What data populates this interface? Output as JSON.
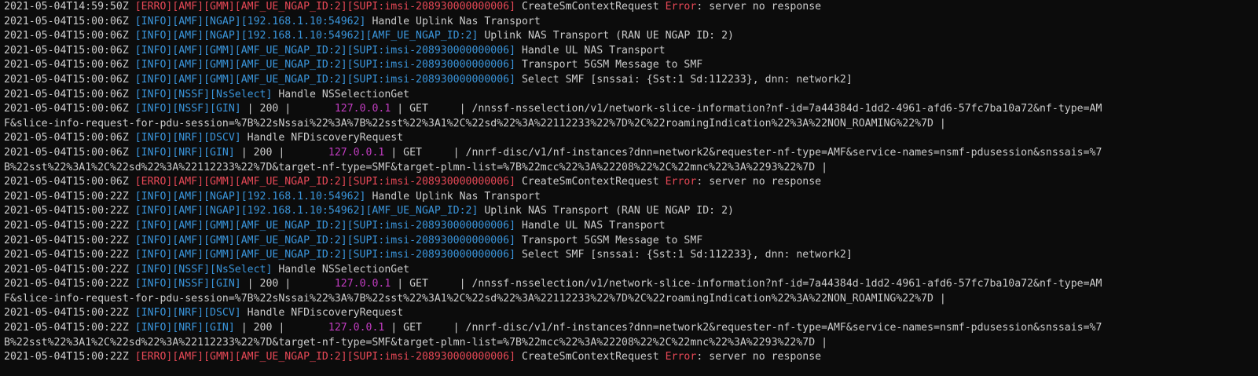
{
  "terminal": {
    "lines": [
      [
        {
          "t": "2021-05-04T14:59:50Z ",
          "c": "ts"
        },
        {
          "t": "[ERRO][AMF][GMM][AMF_UE_NGAP_ID:2][SUPI:imsi-208930000000006]",
          "c": "err"
        },
        {
          "t": " CreateSmContextRequest ",
          "c": "msg"
        },
        {
          "t": "Error",
          "c": "err"
        },
        {
          "t": ": server no response",
          "c": "msg"
        }
      ],
      [
        {
          "t": "2021-05-04T15:00:06Z ",
          "c": "ts"
        },
        {
          "t": "[INFO][AMF][NGAP][192.168.1.10:54962]",
          "c": "tag"
        },
        {
          "t": " Handle Uplink Nas Transport",
          "c": "msg"
        }
      ],
      [
        {
          "t": "2021-05-04T15:00:06Z ",
          "c": "ts"
        },
        {
          "t": "[INFO][AMF][NGAP][192.168.1.10:54962][AMF_UE_NGAP_ID:2]",
          "c": "tag"
        },
        {
          "t": " Uplink NAS Transport (RAN UE NGAP ID: 2)",
          "c": "msg"
        }
      ],
      [
        {
          "t": "2021-05-04T15:00:06Z ",
          "c": "ts"
        },
        {
          "t": "[INFO][AMF][GMM][AMF_UE_NGAP_ID:2][SUPI:imsi-208930000000006]",
          "c": "tag"
        },
        {
          "t": " Handle UL NAS Transport",
          "c": "msg"
        }
      ],
      [
        {
          "t": "2021-05-04T15:00:06Z ",
          "c": "ts"
        },
        {
          "t": "[INFO][AMF][GMM][AMF_UE_NGAP_ID:2][SUPI:imsi-208930000000006]",
          "c": "tag"
        },
        {
          "t": " Transport 5GSM Message to SMF",
          "c": "msg"
        }
      ],
      [
        {
          "t": "2021-05-04T15:00:06Z ",
          "c": "ts"
        },
        {
          "t": "[INFO][AMF][GMM][AMF_UE_NGAP_ID:2][SUPI:imsi-208930000000006]",
          "c": "tag"
        },
        {
          "t": " Select SMF [snssai: {Sst:1 Sd:112233}, dnn: network2]",
          "c": "msg"
        }
      ],
      [
        {
          "t": "2021-05-04T15:00:06Z ",
          "c": "ts"
        },
        {
          "t": "[INFO][NSSF][NsSelect]",
          "c": "tag"
        },
        {
          "t": " Handle NSSelectionGet",
          "c": "msg"
        }
      ],
      [
        {
          "t": "2021-05-04T15:00:06Z ",
          "c": "ts"
        },
        {
          "t": "[INFO][NSSF][GIN]",
          "c": "tag"
        },
        {
          "t": " | 200 |       ",
          "c": "msg"
        },
        {
          "t": "127.0.0.1",
          "c": "ip"
        },
        {
          "t": " | GET     | /nnssf-nsselection/v1/network-slice-information?nf-id=7a44384d-1dd2-4961-afd6-57fc7ba10a72&nf-type=AM",
          "c": "msg"
        }
      ],
      [
        {
          "t": "F&slice-info-request-for-pdu-session=%7B%22sNssai%22%3A%7B%22sst%22%3A1%2C%22sd%22%3A%22112233%22%7D%2C%22roamingIndication%22%3A%22NON_ROAMING%22%7D |",
          "c": "msg"
        }
      ],
      [
        {
          "t": "2021-05-04T15:00:06Z ",
          "c": "ts"
        },
        {
          "t": "[INFO][NRF][DSCV]",
          "c": "tag"
        },
        {
          "t": " Handle NFDiscoveryRequest",
          "c": "msg"
        }
      ],
      [
        {
          "t": "2021-05-04T15:00:06Z ",
          "c": "ts"
        },
        {
          "t": "[INFO][NRF][GIN]",
          "c": "tag"
        },
        {
          "t": " | 200 |       ",
          "c": "msg"
        },
        {
          "t": "127.0.0.1",
          "c": "ip"
        },
        {
          "t": " | GET     | /nnrf-disc/v1/nf-instances?dnn=network2&requester-nf-type=AMF&service-names=nsmf-pdusession&snssais=%7",
          "c": "msg"
        }
      ],
      [
        {
          "t": "B%22sst%22%3A1%2C%22sd%22%3A%22112233%22%7D&target-nf-type=SMF&target-plmn-list=%7B%22mcc%22%3A%22208%22%2C%22mnc%22%3A%2293%22%7D |",
          "c": "msg"
        }
      ],
      [
        {
          "t": "2021-05-04T15:00:06Z ",
          "c": "ts"
        },
        {
          "t": "[ERRO][AMF][GMM][AMF_UE_NGAP_ID:2][SUPI:imsi-208930000000006]",
          "c": "err"
        },
        {
          "t": " CreateSmContextRequest ",
          "c": "msg"
        },
        {
          "t": "Error",
          "c": "err"
        },
        {
          "t": ": server no response",
          "c": "msg"
        }
      ],
      [
        {
          "t": "2021-05-04T15:00:22Z ",
          "c": "ts"
        },
        {
          "t": "[INFO][AMF][NGAP][192.168.1.10:54962]",
          "c": "tag"
        },
        {
          "t": " Handle Uplink Nas Transport",
          "c": "msg"
        }
      ],
      [
        {
          "t": "2021-05-04T15:00:22Z ",
          "c": "ts"
        },
        {
          "t": "[INFO][AMF][NGAP][192.168.1.10:54962][AMF_UE_NGAP_ID:2]",
          "c": "tag"
        },
        {
          "t": " Uplink NAS Transport (RAN UE NGAP ID: 2)",
          "c": "msg"
        }
      ],
      [
        {
          "t": "2021-05-04T15:00:22Z ",
          "c": "ts"
        },
        {
          "t": "[INFO][AMF][GMM][AMF_UE_NGAP_ID:2][SUPI:imsi-208930000000006]",
          "c": "tag"
        },
        {
          "t": " Handle UL NAS Transport",
          "c": "msg"
        }
      ],
      [
        {
          "t": "2021-05-04T15:00:22Z ",
          "c": "ts"
        },
        {
          "t": "[INFO][AMF][GMM][AMF_UE_NGAP_ID:2][SUPI:imsi-208930000000006]",
          "c": "tag"
        },
        {
          "t": " Transport 5GSM Message to SMF",
          "c": "msg"
        }
      ],
      [
        {
          "t": "2021-05-04T15:00:22Z ",
          "c": "ts"
        },
        {
          "t": "[INFO][AMF][GMM][AMF_UE_NGAP_ID:2][SUPI:imsi-208930000000006]",
          "c": "tag"
        },
        {
          "t": " Select SMF [snssai: {Sst:1 Sd:112233}, dnn: network2]",
          "c": "msg"
        }
      ],
      [
        {
          "t": "2021-05-04T15:00:22Z ",
          "c": "ts"
        },
        {
          "t": "[INFO][NSSF][NsSelect]",
          "c": "tag"
        },
        {
          "t": " Handle NSSelectionGet",
          "c": "msg"
        }
      ],
      [
        {
          "t": "2021-05-04T15:00:22Z ",
          "c": "ts"
        },
        {
          "t": "[INFO][NSSF][GIN]",
          "c": "tag"
        },
        {
          "t": " | 200 |       ",
          "c": "msg"
        },
        {
          "t": "127.0.0.1",
          "c": "ip"
        },
        {
          "t": " | GET     | /nnssf-nsselection/v1/network-slice-information?nf-id=7a44384d-1dd2-4961-afd6-57fc7ba10a72&nf-type=AM",
          "c": "msg"
        }
      ],
      [
        {
          "t": "F&slice-info-request-for-pdu-session=%7B%22sNssai%22%3A%7B%22sst%22%3A1%2C%22sd%22%3A%22112233%22%7D%2C%22roamingIndication%22%3A%22NON_ROAMING%22%7D |",
          "c": "msg"
        }
      ],
      [
        {
          "t": "2021-05-04T15:00:22Z ",
          "c": "ts"
        },
        {
          "t": "[INFO][NRF][DSCV]",
          "c": "tag"
        },
        {
          "t": " Handle NFDiscoveryRequest",
          "c": "msg"
        }
      ],
      [
        {
          "t": "2021-05-04T15:00:22Z ",
          "c": "ts"
        },
        {
          "t": "[INFO][NRF][GIN]",
          "c": "tag"
        },
        {
          "t": " | 200 |       ",
          "c": "msg"
        },
        {
          "t": "127.0.0.1",
          "c": "ip"
        },
        {
          "t": " | GET     | /nnrf-disc/v1/nf-instances?dnn=network2&requester-nf-type=AMF&service-names=nsmf-pdusession&snssais=%7",
          "c": "msg"
        }
      ],
      [
        {
          "t": "B%22sst%22%3A1%2C%22sd%22%3A%22112233%22%7D&target-nf-type=SMF&target-plmn-list=%7B%22mcc%22%3A%22208%22%2C%22mnc%22%3A%2293%22%7D |",
          "c": "msg"
        }
      ],
      [
        {
          "t": "2021-05-04T15:00:22Z ",
          "c": "ts"
        },
        {
          "t": "[ERRO][AMF][GMM][AMF_UE_NGAP_ID:2][SUPI:imsi-208930000000006]",
          "c": "err"
        },
        {
          "t": " CreateSmContextRequest ",
          "c": "msg"
        },
        {
          "t": "Error",
          "c": "err"
        },
        {
          "t": ": server no response",
          "c": "msg"
        }
      ]
    ]
  },
  "colors": {
    "background": "#0c0c0c",
    "text": "#cccccc",
    "info_tag": "#3a96dd",
    "error": "#e74856",
    "ip": "#c13cc0"
  }
}
